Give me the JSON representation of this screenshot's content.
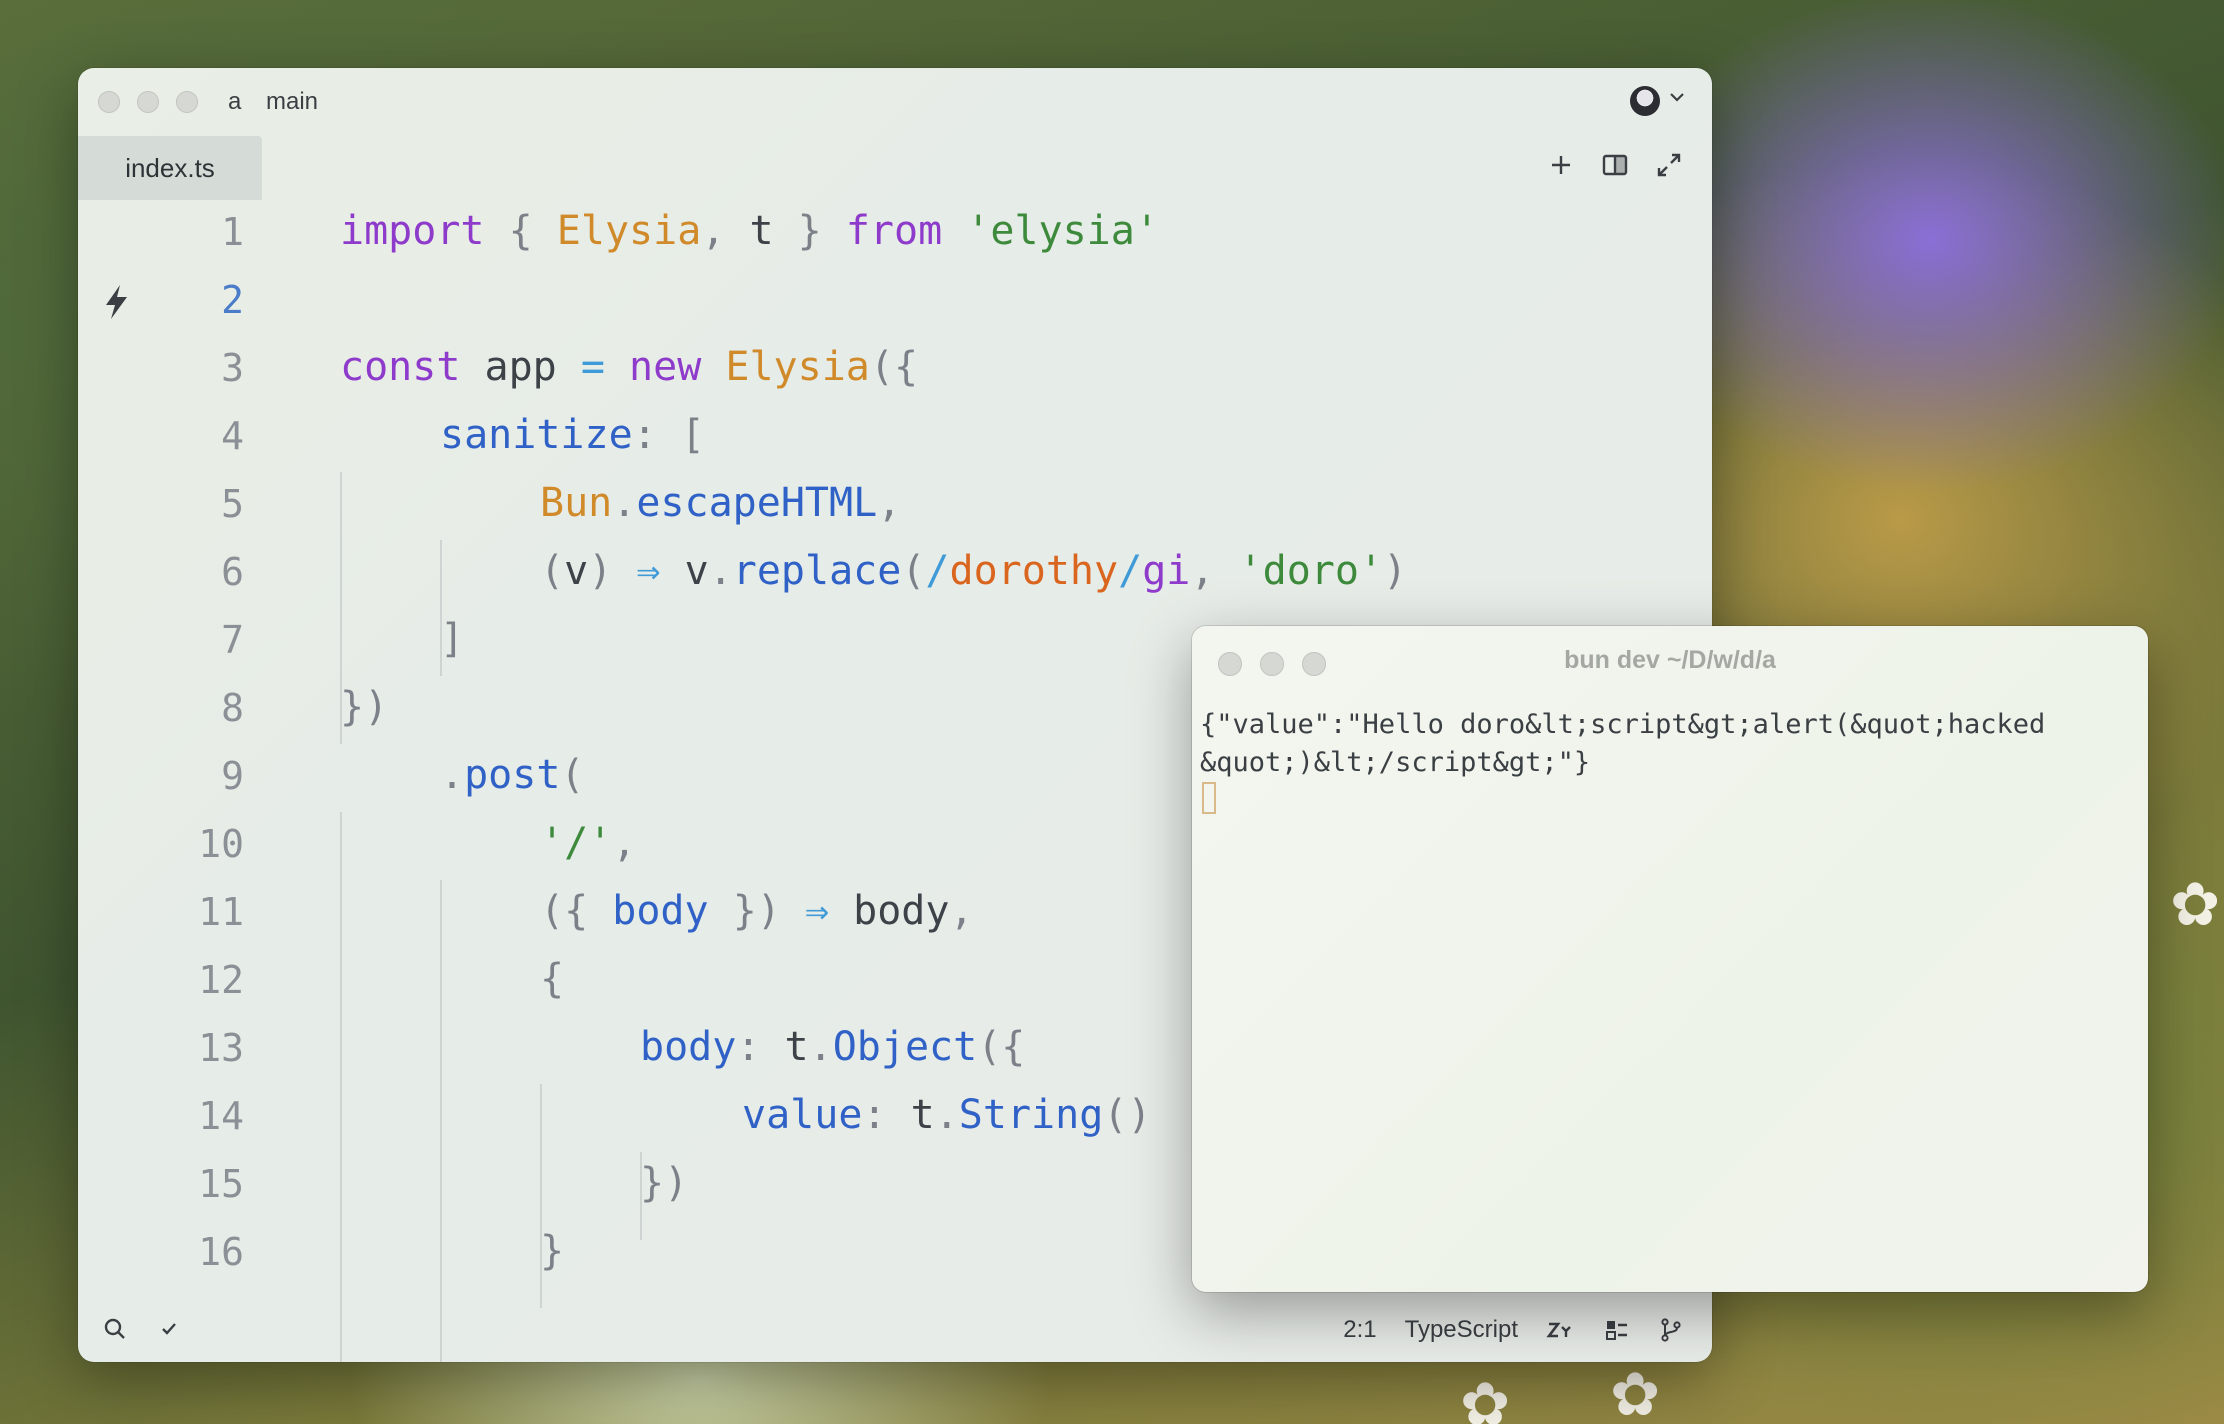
{
  "editor": {
    "project": "a",
    "branch": "main",
    "tab": "index.ts",
    "tab_actions": [
      "plus-icon",
      "split-pane-icon",
      "expand-icon"
    ],
    "lines": [
      {
        "n": "1"
      },
      {
        "n": "2"
      },
      {
        "n": "3"
      },
      {
        "n": "4"
      },
      {
        "n": "5"
      },
      {
        "n": "6"
      },
      {
        "n": "7"
      },
      {
        "n": "8"
      },
      {
        "n": "9"
      },
      {
        "n": "10"
      },
      {
        "n": "11"
      },
      {
        "n": "12"
      },
      {
        "n": "13"
      },
      {
        "n": "14"
      },
      {
        "n": "15"
      },
      {
        "n": "16"
      }
    ],
    "code": {
      "l1": [
        "import",
        "{",
        "Elysia",
        ",",
        "t",
        "}",
        "from",
        "'elysia'"
      ],
      "l3": [
        "const",
        "app",
        "=",
        "new",
        "Elysia",
        "({"
      ],
      "l4": [
        "sanitize",
        ":",
        "["
      ],
      "l5": [
        "Bun",
        ".",
        "escapeHTML",
        ","
      ],
      "l6": [
        "(",
        "v",
        ")",
        "⇒",
        "v",
        ".",
        "replace",
        "(",
        "/",
        "dorothy",
        "/",
        "gi",
        ",",
        "'doro'",
        ")"
      ],
      "l7": [
        "]"
      ],
      "l8": [
        "})"
      ],
      "l9": [
        ".",
        "post",
        "("
      ],
      "l10": [
        "'/'",
        ","
      ],
      "l11": [
        "({",
        "body",
        "})",
        "⇒",
        "body",
        ","
      ],
      "l12": [
        "{"
      ],
      "l13": [
        "body",
        ":",
        "t",
        ".",
        "Object",
        "({"
      ],
      "l14": [
        "value",
        ":",
        "t",
        ".",
        "String",
        "()"
      ],
      "l15": [
        "})"
      ],
      "l16": [
        "}"
      ]
    },
    "status": {
      "cursor": "2:1",
      "language": "TypeScript"
    }
  },
  "terminal": {
    "title": "bun dev ~/D/w/d/a",
    "output_line1": "{\"value\":\"Hello doro&lt;script&gt;alert(&quot;hacked",
    "output_line2": "&quot;)&lt;/script&gt;\"}"
  }
}
